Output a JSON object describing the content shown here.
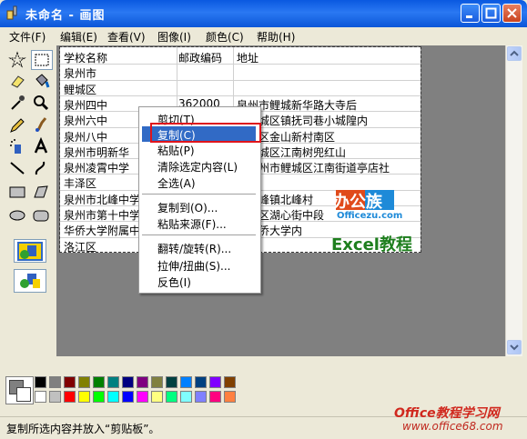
{
  "window": {
    "title": "未命名 - 画图"
  },
  "menu": [
    "文件(F)",
    "编辑(E)",
    "查看(V)",
    "图像(I)",
    "颜色(C)",
    "帮助(H)"
  ],
  "table": {
    "headers": [
      "学校名称",
      "邮政编码",
      "地址"
    ],
    "rows": [
      [
        "泉州市",
        "",
        ""
      ],
      [
        "鲤城区",
        "",
        ""
      ],
      [
        "泉州四中",
        "362000",
        "泉州市鲤城新华路大寺后"
      ],
      [
        "泉州六中",
        "",
        "市鲤城区镇抚司巷小城隍内"
      ],
      [
        "泉州八中",
        "",
        "鲤城区金山新村南区"
      ],
      [
        "泉州市明新华",
        "",
        "市鲤城区江南树兜红山"
      ],
      [
        "泉州凌霄中学",
        "",
        "省泉州市鲤城区江南街道亭店社"
      ],
      [
        "丰泽区",
        "",
        ""
      ],
      [
        "泉州市北峰中学",
        "",
        "区北峰镇北峰村"
      ],
      [
        "泉州市第十中学",
        "",
        "丰泽区湖心街中段"
      ],
      [
        "华侨大学附属中",
        "",
        "市华侨大学内"
      ],
      [
        "洛江区",
        "",
        ""
      ]
    ]
  },
  "context_menu": {
    "items": [
      {
        "label": "剪切(T)",
        "highlighted": false
      },
      {
        "label": "复制(C)",
        "highlighted": true
      },
      {
        "label": "粘贴(P)",
        "highlighted": false
      },
      {
        "label": "清除选定内容(L)",
        "highlighted": false
      },
      {
        "label": "全选(A)",
        "highlighted": false
      },
      {
        "label": "复制到(O)...",
        "highlighted": false
      },
      {
        "label": "粘贴来源(F)...",
        "highlighted": false
      },
      {
        "label": "翻转/旋转(R)...",
        "highlighted": false
      },
      {
        "label": "拉伸/扭曲(S)...",
        "highlighted": false
      },
      {
        "label": "反色(I)",
        "highlighted": false
      }
    ]
  },
  "palette": {
    "row1": [
      "#000000",
      "#808080",
      "#800000",
      "#808000",
      "#008000",
      "#008080",
      "#000080",
      "#800080",
      "#808040",
      "#004040",
      "#0080ff",
      "#004080",
      "#8000ff",
      "#804000"
    ],
    "row2": [
      "#ffffff",
      "#c0c0c0",
      "#ff0000",
      "#ffff00",
      "#00ff00",
      "#00ffff",
      "#0000ff",
      "#ff00ff",
      "#ffff80",
      "#00ff80",
      "#80ffff",
      "#8080ff",
      "#ff0080",
      "#ff8040"
    ]
  },
  "status": {
    "text": "复制所选内容并放入“剪贴板”。"
  },
  "watermarks": {
    "logo_text": "办公族",
    "logo_url": "Officezu.com",
    "excel": "Excel教程",
    "office": "Office教程学习网",
    "url": "www.office68.com"
  },
  "colors": {
    "titlebar": "#0a59e0",
    "highlight": "#316ac5",
    "annotation_red": "#e0141b",
    "canvas_bg": "#808080"
  }
}
